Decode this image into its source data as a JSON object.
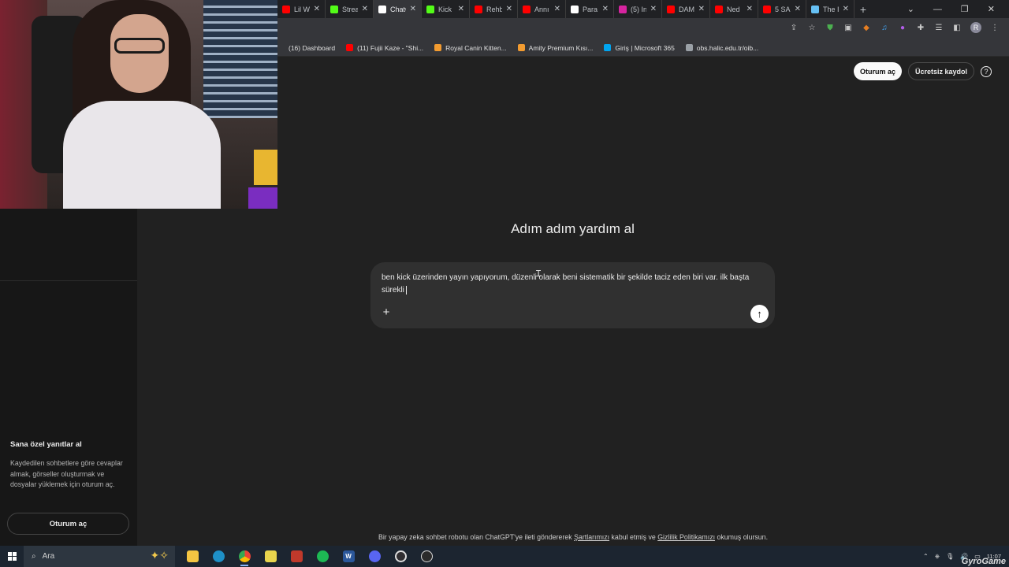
{
  "browser": {
    "tabs": [
      {
        "title": "Lil W",
        "icon": "youtube-icon",
        "color": "#ff0000"
      },
      {
        "title": "Strea",
        "icon": "kick-icon",
        "color": "#53fc18"
      },
      {
        "title": "ChatG",
        "icon": "chatgpt-icon",
        "color": "#ffffff",
        "active": true
      },
      {
        "title": "Kick",
        "icon": "kick-icon",
        "color": "#53fc18"
      },
      {
        "title": "Rehb",
        "icon": "youtube-icon",
        "color": "#ff0000"
      },
      {
        "title": "Annı",
        "icon": "youtube-icon",
        "color": "#ff0000"
      },
      {
        "title": "Para",
        "icon": "google-icon",
        "color": "#ffffff"
      },
      {
        "title": "(5) In",
        "icon": "instagram-icon",
        "color": "#d6249f"
      },
      {
        "title": "DAM",
        "icon": "youtube-icon",
        "color": "#ff0000"
      },
      {
        "title": "Ned",
        "icon": "youtube-icon",
        "color": "#ff0000"
      },
      {
        "title": "5 SA",
        "icon": "youtube-icon",
        "color": "#ff0000"
      },
      {
        "title": "The I",
        "icon": "steam-icon",
        "color": "#66c0f4"
      }
    ],
    "new_tab": "+",
    "bookmarks": [
      {
        "label": "(16) Dashboard",
        "color": "#35363a"
      },
      {
        "label": "(11) Fujii Kaze - \"Shi...",
        "color": "#ff0000"
      },
      {
        "label": "Royal Canin Kitten...",
        "color": "#f29b30"
      },
      {
        "label": "Amity Premium Kısı...",
        "color": "#f29b30"
      },
      {
        "label": "Giriş | Microsoft 365",
        "color": "#00a4ef"
      },
      {
        "label": "obs.halic.edu.tr/oib...",
        "color": "#9aa0a6"
      }
    ],
    "profile_initial": "R"
  },
  "sidebar": {
    "promo_title": "Sana özel yanıtlar al",
    "promo_desc": "Kaydedilen sohbetlere göre cevaplar almak, görseller oluşturmak ve dosyalar yüklemek için oturum aç.",
    "login_label": "Oturum aç"
  },
  "header": {
    "login_label": "Oturum aç",
    "signup_label": "Ücretsiz kaydol",
    "help_label": "?"
  },
  "main": {
    "heading": "Adım adım yardım al",
    "composer_text": "ben kick üzerinden yayın yapıyorum, düzenli olarak beni sistematik bir şekilde taciz eden biri var. ilk başta sürekli",
    "plus_label": "+",
    "send_label": "↑"
  },
  "footer": {
    "prefix": "Bir yapay zeka sohbet robotu olan ChatGPT'ye ileti göndererek ",
    "terms": "Şartlarımızı",
    "middle": " kabul etmiş ve ",
    "privacy": "Gizlilik Politikamızı",
    "suffix": " okumuş olursun."
  },
  "taskbar": {
    "search_placeholder": "Ara",
    "time": "11:07",
    "watermark": "GyroGame"
  }
}
